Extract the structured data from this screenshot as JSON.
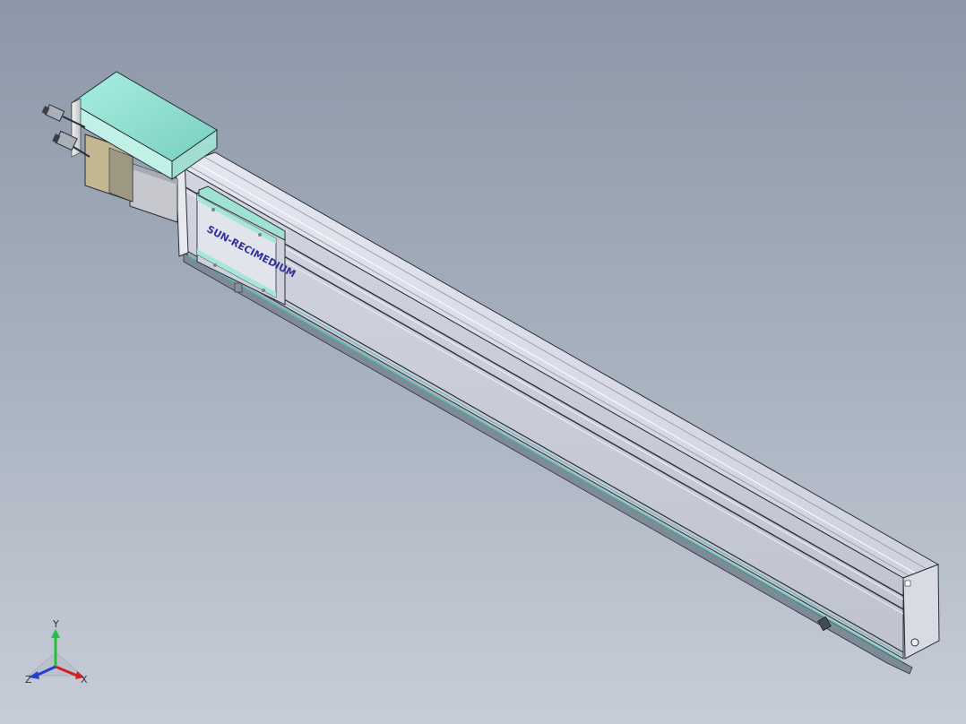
{
  "viewport": {
    "background_top": "#8c97a7",
    "background_bottom": "#c7cdd7"
  },
  "model": {
    "carriage_logo_text": "SUN-RECIMEDIUM",
    "colors": {
      "profile_top": "#d8dbe7",
      "profile_side": "#c9ccd8",
      "motor_cover": "#8fe0d2",
      "carriage_plate": "#a5e6d8",
      "edge_line": "#2a2d36",
      "logo": "#30309a"
    }
  },
  "triad": {
    "x_label": "X",
    "y_label": "Y",
    "z_label": "Z",
    "x_color": "#d02020",
    "y_color": "#20c040",
    "z_color": "#2040d0"
  }
}
